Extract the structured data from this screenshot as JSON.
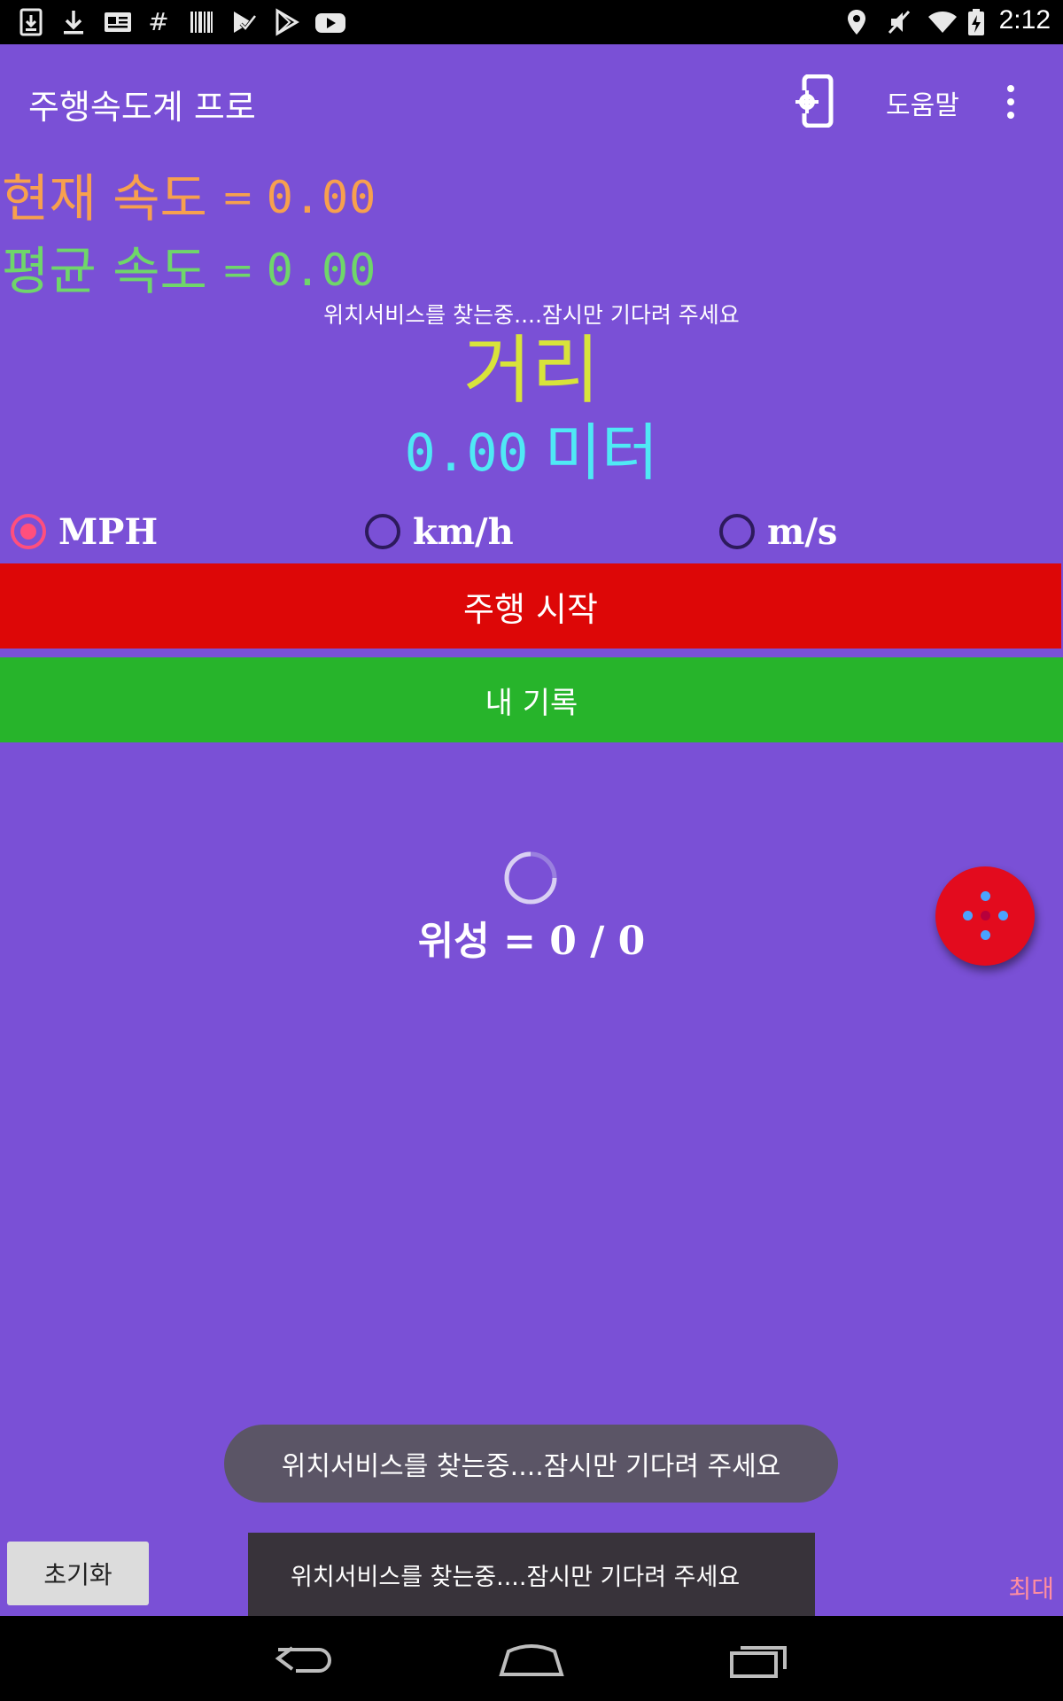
{
  "status_bar": {
    "time": "2:12",
    "left_icons": [
      "download-box-icon",
      "download-icon",
      "newspaper-icon",
      "hashtag-icon",
      "barcode-icon",
      "play-check-icon",
      "play-store-icon",
      "youtube-icon"
    ],
    "right_icons": [
      "location-icon",
      "mute-icon",
      "wifi-icon",
      "battery-charging-icon"
    ]
  },
  "app_bar": {
    "title": "주행속도계 프로",
    "help_label": "도움말"
  },
  "speeds": {
    "current_label": "현재 속도",
    "current_value": "0.00",
    "average_label": "평균 속도",
    "average_value": "0.00",
    "equals": "="
  },
  "gps_message": "위치서비스를 찾는중....잠시만 기다려 주세요",
  "distance": {
    "title": "거리",
    "value": "0.00",
    "unit": "미터"
  },
  "units": {
    "options": [
      "MPH",
      "km/h",
      "m/s"
    ],
    "selected": "MPH"
  },
  "buttons": {
    "start": "주행 시작",
    "records": "내 기록",
    "reset": "초기화"
  },
  "satellites": {
    "text": "위성 = 0 / 0"
  },
  "toasts": {
    "pill": "위치서비스를 찾는중....잠시만 기다려 주세요",
    "box": "위치서비스를 찾는중....잠시만 기다려 주세요"
  },
  "max_label": "최대",
  "colors": {
    "background": "#7a50d6",
    "current_speed": "#f7a04e",
    "average_speed": "#6fd66a",
    "distance_title": "#d8e33a",
    "distance_value": "#4fe9f5",
    "start_button": "#dd0707",
    "records_button": "#27b42b",
    "fab": "#e30b1e"
  }
}
